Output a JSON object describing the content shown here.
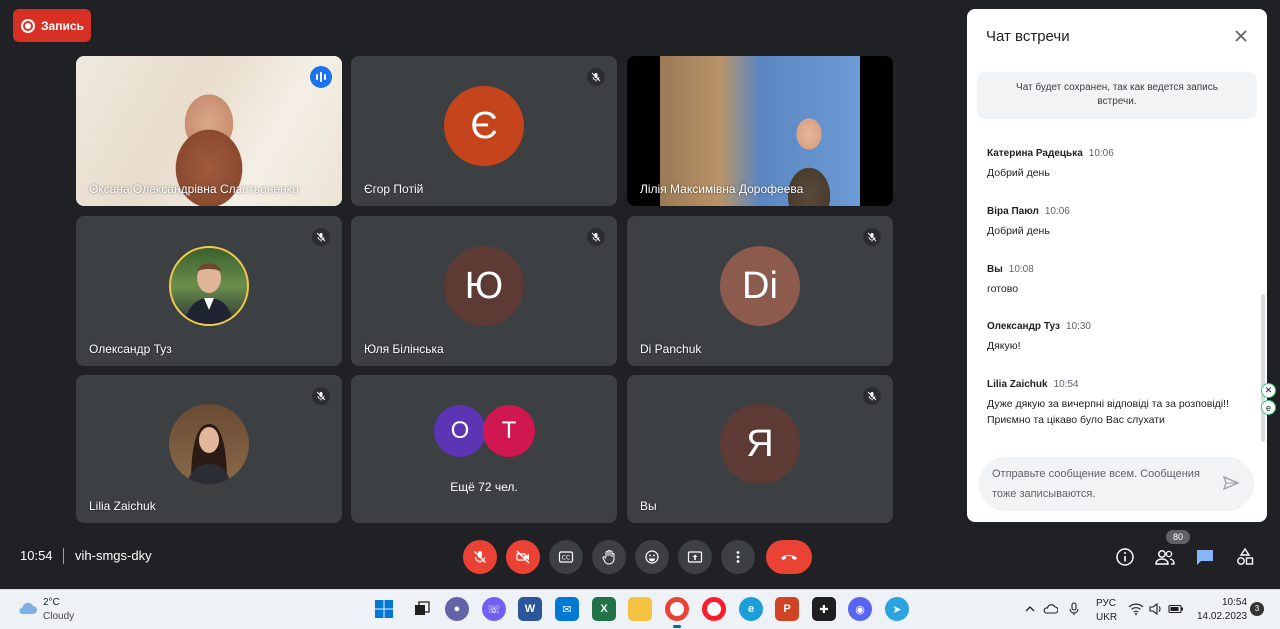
{
  "record": {
    "label": "Запись"
  },
  "tiles": [
    {
      "name": "Оксана Олександрівна Сластьоненко"
    },
    {
      "name": "Єгор Потій",
      "initial": "Є",
      "color": "#c5441c"
    },
    {
      "name": "Лілія Максимівна Дорофеева"
    },
    {
      "name": "Олександр Туз"
    },
    {
      "name": "Юля Білінська",
      "initial": "Ю",
      "color": "#5d3a33"
    },
    {
      "name": "Di Panchuk",
      "initial": "Di",
      "color": "#8d5a4e"
    },
    {
      "name": "Lilia Zaichuk"
    },
    {
      "more_label": "Ещё 72 чел.",
      "bubbles": [
        {
          "initial": "О",
          "color": "#5b35b3"
        },
        {
          "initial": "Т",
          "color": "#d0174f"
        }
      ]
    },
    {
      "name": "Вы",
      "initial": "Я",
      "color": "#5d3a33"
    }
  ],
  "chat": {
    "title": "Чат встречи",
    "notice": "Чат будет сохранен, так как ведется запись встречи.",
    "messages": [
      {
        "author": "Катерина Радецька",
        "time": "10:06",
        "text": "Добрий день"
      },
      {
        "author": "Віра Паюл",
        "time": "10:06",
        "text": "Добрий день"
      },
      {
        "author": "Вы",
        "time": "10:08",
        "text": "готово"
      },
      {
        "author": "Олександр Туз",
        "time": "10:30",
        "text": "Дякую!"
      },
      {
        "author": "Lilia Zaichuk",
        "time": "10:54",
        "text": "Дуже дякую за вичерпні відповіді та за розповіді!! Приємно та цікаво було Вас слухати"
      }
    ],
    "input_placeholder": "Отправьте сообщение всем. Сообщения тоже записываются."
  },
  "bottom": {
    "time": "10:54",
    "meeting_code": "vih-smgs-dky",
    "participants_count": "80"
  },
  "taskbar": {
    "weather_temp": "2°C",
    "weather_desc": "Cloudy",
    "lang_top": "РУС",
    "lang_bottom": "UKR",
    "clock_time": "10:54",
    "clock_date": "14.02.2023",
    "notifications": "3"
  },
  "colors": {
    "accent": "#1a73e8",
    "danger": "#ea4335",
    "tile": "#3c4043",
    "background": "#202124"
  }
}
